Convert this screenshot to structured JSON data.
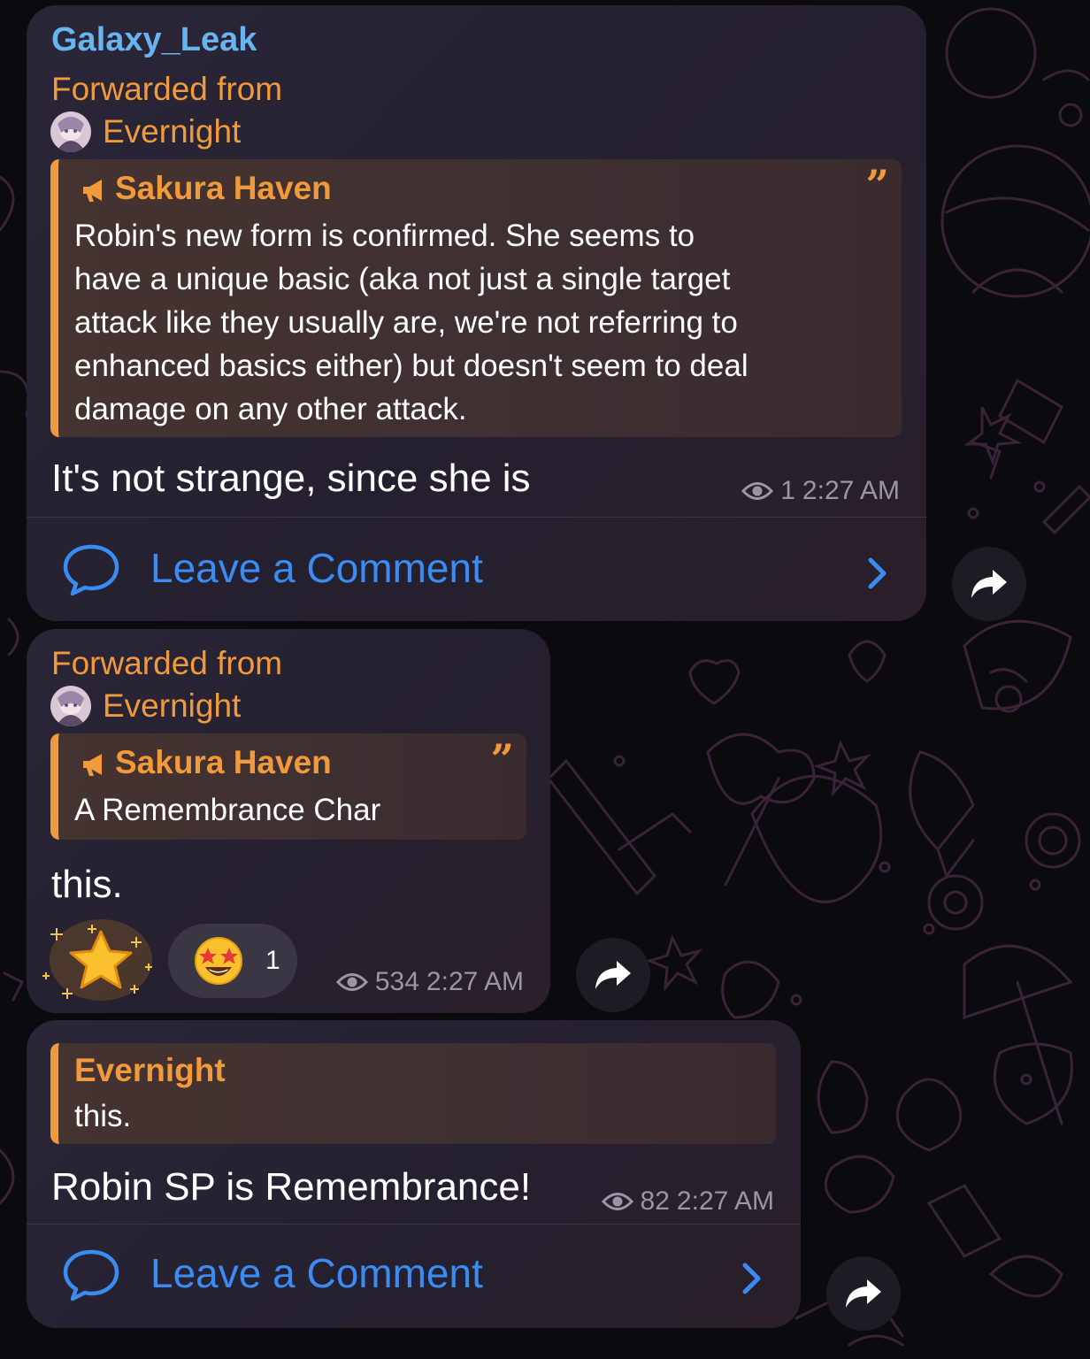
{
  "messages": [
    {
      "channel": "Galaxy_Leak",
      "forward_label": "Forwarded from",
      "forward_from": "Evernight",
      "quote_author": "Sakura Haven",
      "quote_lines": [
        "Robin's new form is confirmed. She seems to",
        "have a unique basic (aka not just a single target",
        "attack like they usually are, we're not referring to",
        "enhanced basics either) but doesn't seem to deal",
        "damage on any other attack."
      ],
      "text": "It's not strange, since she is",
      "views": "1",
      "time": "2:27 AM",
      "comment_label": "Leave a Comment"
    },
    {
      "forward_label": "Forwarded from",
      "forward_from": "Evernight",
      "quote_author": "Sakura Haven",
      "quote_text": "A Remembrance Char",
      "text": "this.",
      "reactions": [
        {
          "emoji": "star",
          "count": ""
        },
        {
          "emoji": "star-struck",
          "count": "1"
        }
      ],
      "views": "534",
      "time": "2:27 AM"
    },
    {
      "reply_author": "Evernight",
      "reply_text": "this.",
      "text": "Robin SP is Remembrance!",
      "views": "82",
      "time": "2:27 AM",
      "comment_label": "Leave a Comment"
    }
  ],
  "icons": {
    "views": "eye-icon",
    "comments": "comment-bubble-icon",
    "chevron": "chevron-right-icon",
    "share": "share-arrow-icon",
    "channel": "megaphone-icon",
    "quote": "quote-mark-icon"
  },
  "colors": {
    "channel_name": "#67b4ef",
    "forward": "#f09a3c",
    "link": "#3a8cf3",
    "meta": "#9a96a4",
    "background": "#0b0a0e"
  }
}
